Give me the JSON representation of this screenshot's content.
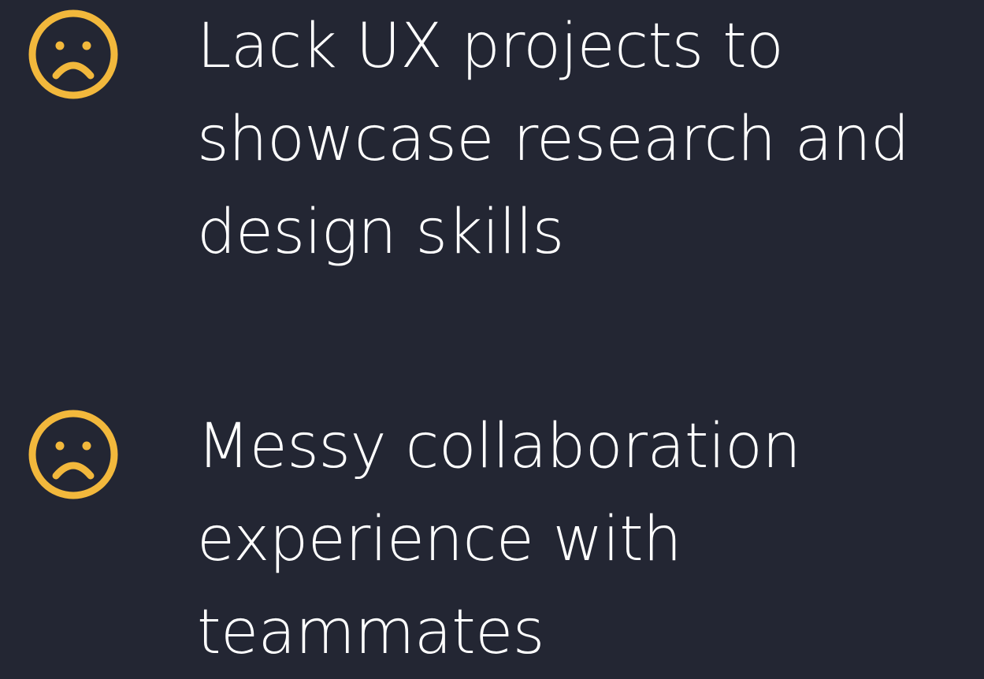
{
  "accent_color": "#f2b83c",
  "background_color": "#232633",
  "pain_points": [
    {
      "icon": "sad-face-icon",
      "lines": [
        "Lack UX projects to",
        "showcase research and",
        "design skills"
      ]
    },
    {
      "icon": "sad-face-icon",
      "lines": [
        "Messy collaboration",
        "experience with",
        "teammates"
      ]
    }
  ]
}
